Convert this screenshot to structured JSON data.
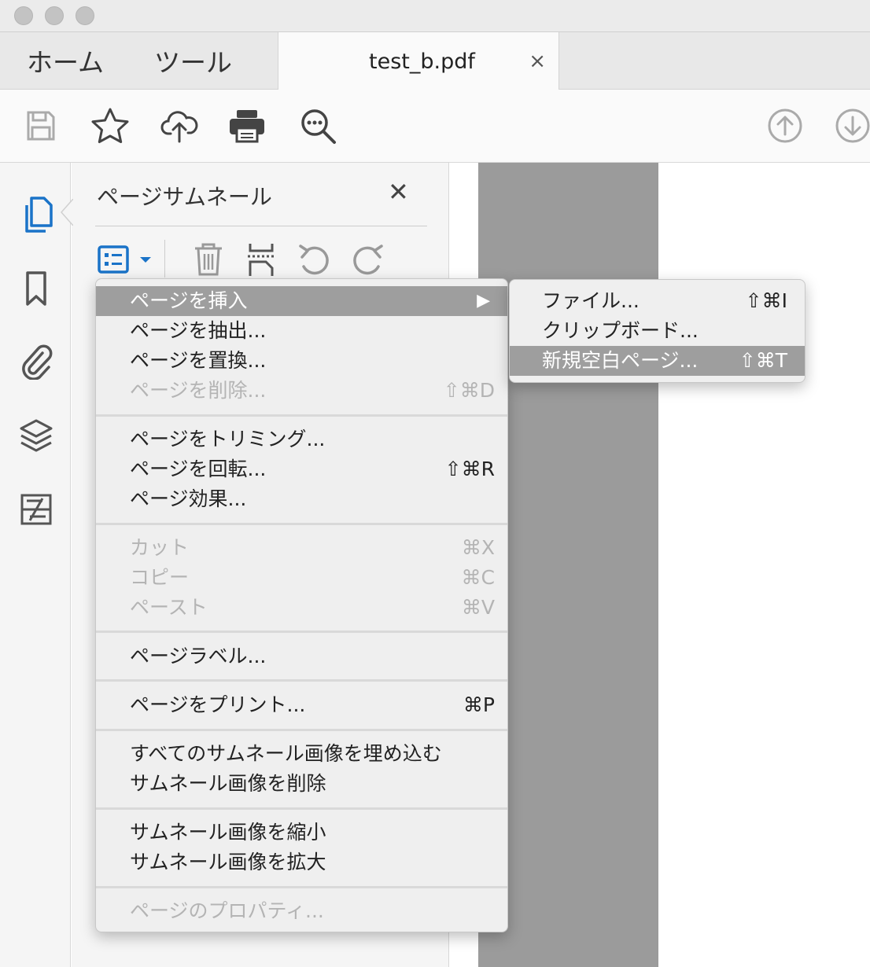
{
  "tabs": {
    "home": "ホーム",
    "tools": "ツール"
  },
  "document": {
    "filename": "test_b.pdf",
    "close_glyph": "×"
  },
  "toolbar": {
    "icons": [
      "save-icon",
      "star-icon",
      "cloud-upload-icon",
      "print-icon",
      "zoom-icon",
      "page-up-icon",
      "page-down-icon"
    ]
  },
  "left_tools": [
    "page-thumbnails-icon",
    "bookmark-icon",
    "attachment-icon",
    "layers-icon",
    "content-icon"
  ],
  "panel": {
    "title": "ページサムネール",
    "close_glyph": "✕"
  },
  "colors": {
    "accent": "#1a73c8",
    "highlight": "#9e9e9e",
    "menu_bg": "#efefef",
    "disabled": "#b4b4b4"
  },
  "menu": {
    "items": [
      {
        "label": "ページを挿入",
        "shortcut": "",
        "arrow": "▶",
        "state": "highlighted"
      },
      {
        "label": "ページを抽出...",
        "shortcut": "",
        "state": "enabled"
      },
      {
        "label": "ページを置換...",
        "shortcut": "",
        "state": "enabled"
      },
      {
        "label": "ページを削除...",
        "shortcut": "⇧⌘D",
        "state": "disabled"
      },
      {
        "label": "ページをトリミング...",
        "shortcut": "",
        "state": "enabled"
      },
      {
        "label": "ページを回転...",
        "shortcut": "⇧⌘R",
        "state": "enabled"
      },
      {
        "label": "ページ効果...",
        "shortcut": "",
        "state": "enabled"
      },
      {
        "label": "カット",
        "shortcut": "⌘X",
        "state": "disabled"
      },
      {
        "label": "コピー",
        "shortcut": "⌘C",
        "state": "disabled"
      },
      {
        "label": "ペースト",
        "shortcut": "⌘V",
        "state": "disabled"
      },
      {
        "label": "ページラベル...",
        "shortcut": "",
        "state": "enabled"
      },
      {
        "label": "ページをプリント...",
        "shortcut": "⌘P",
        "state": "enabled"
      },
      {
        "label": "すべてのサムネール画像を埋め込む",
        "shortcut": "",
        "state": "enabled"
      },
      {
        "label": "サムネール画像を削除",
        "shortcut": "",
        "state": "enabled"
      },
      {
        "label": "サムネール画像を縮小",
        "shortcut": "",
        "state": "enabled"
      },
      {
        "label": "サムネール画像を拡大",
        "shortcut": "",
        "state": "enabled"
      },
      {
        "label": "ページのプロパティ...",
        "shortcut": "",
        "state": "disabled"
      }
    ]
  },
  "submenu": {
    "items": [
      {
        "label": "ファイル...",
        "shortcut": "⇧⌘I",
        "state": "enabled"
      },
      {
        "label": "クリップボード...",
        "shortcut": "",
        "state": "enabled"
      },
      {
        "label": "新規空白ページ...",
        "shortcut": "⇧⌘T",
        "state": "highlighted"
      }
    ]
  }
}
